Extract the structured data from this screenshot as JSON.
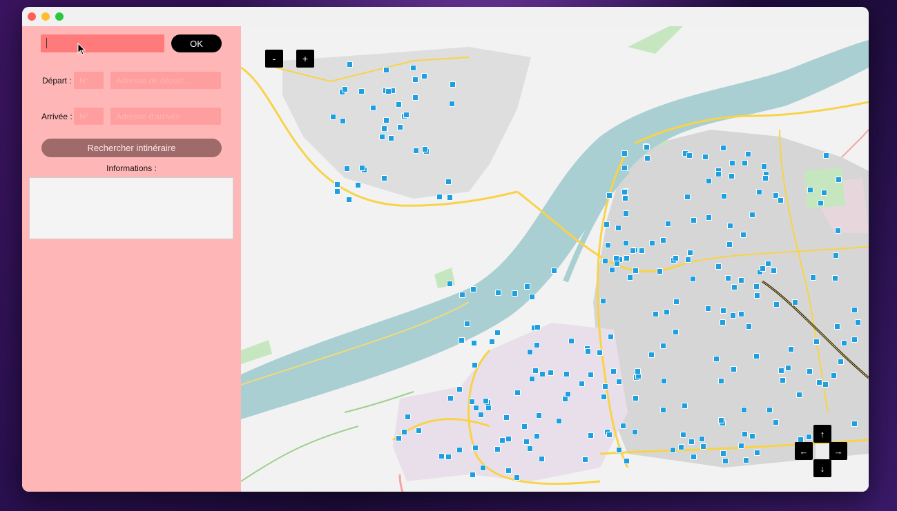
{
  "sidebar": {
    "search": {
      "value": ""
    },
    "ok_label": "OK",
    "depart_label": "Départ :",
    "depart_number_placeholder": "N°",
    "depart_address_placeholder": "Adresse de départ ...",
    "arrivee_label": "Arrivée :",
    "arrivee_number_placeholder": "N°",
    "arrivee_address_placeholder": "Adresse d'arrivée",
    "route_button_label": "Rechercher intinéraire",
    "info_label": "Informations :"
  },
  "map": {
    "zoom_out_label": "-",
    "zoom_in_label": "+",
    "pan_up_label": "↑",
    "pan_down_label": "↓",
    "pan_left_label": "←",
    "pan_right_label": "→",
    "colors": {
      "background": "#f2f2f2",
      "river": "#aacfd2",
      "main_road": "#f8d348",
      "residential": "#e6e1ea",
      "dense_urban": "#d9d9d9",
      "park": "#c6e6c0",
      "stop_icon": "#1e9fe0"
    },
    "icon": "bus-stop-icon"
  },
  "colors": {
    "sidebar": "#ffb6b6",
    "search_input": "#ff7a7a",
    "field": "#ff9e9e",
    "route_button": "#9e6a6a",
    "ok_button": "#000000"
  }
}
